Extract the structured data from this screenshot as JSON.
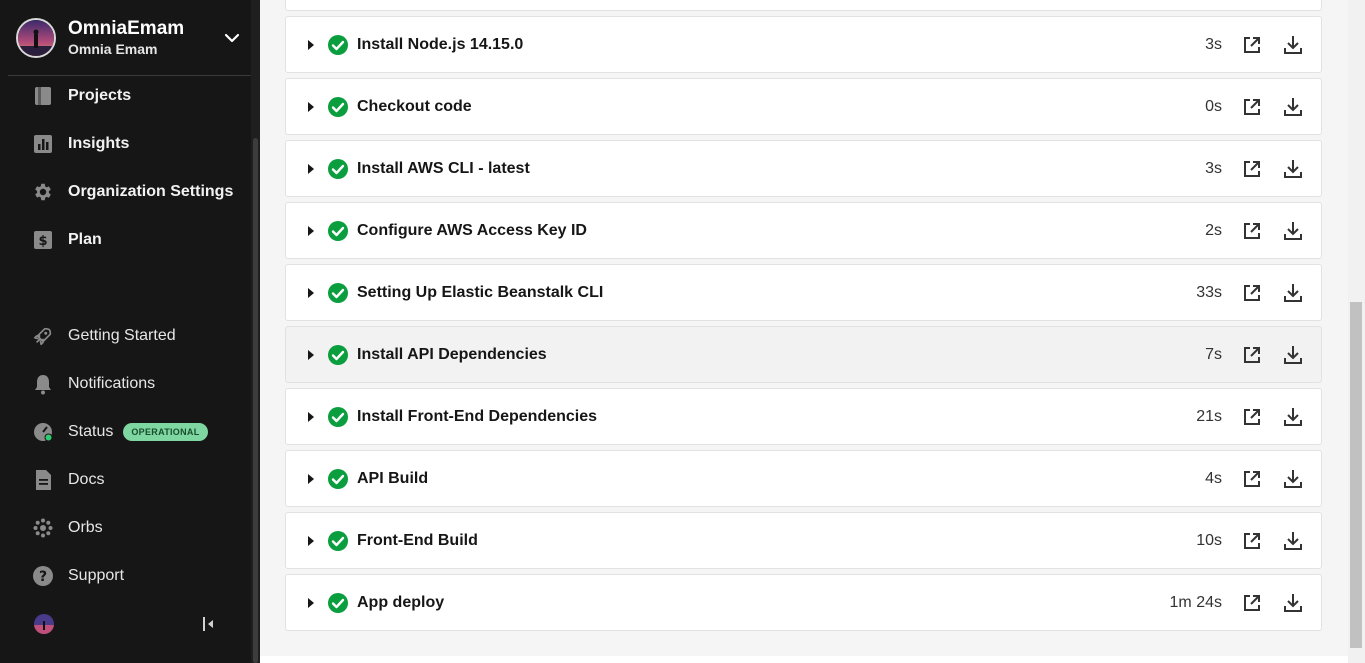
{
  "sidebar": {
    "org_name": "OmniaEmam",
    "user_name": "Omnia Emam",
    "primary_nav": [
      {
        "label": "Projects",
        "icon": "book-icon"
      },
      {
        "label": "Insights",
        "icon": "chart-icon"
      },
      {
        "label": "Organization Settings",
        "icon": "gear-icon"
      },
      {
        "label": "Plan",
        "icon": "dollar-icon"
      }
    ],
    "secondary_nav": [
      {
        "label": "Getting Started",
        "icon": "rocket-icon"
      },
      {
        "label": "Notifications",
        "icon": "bell-icon"
      },
      {
        "label": "Status",
        "icon": "status-icon",
        "badge": "OPERATIONAL"
      },
      {
        "label": "Docs",
        "icon": "doc-icon"
      },
      {
        "label": "Orbs",
        "icon": "orbs-icon"
      },
      {
        "label": "Support",
        "icon": "help-icon"
      }
    ]
  },
  "steps": [
    {
      "name": "Install Node.js 14.15.0",
      "duration": "3s"
    },
    {
      "name": "Checkout code",
      "duration": "0s"
    },
    {
      "name": "Install AWS CLI - latest",
      "duration": "3s"
    },
    {
      "name": "Configure AWS Access Key ID",
      "duration": "2s"
    },
    {
      "name": "Setting Up Elastic Beanstalk CLI",
      "duration": "33s"
    },
    {
      "name": "Install API Dependencies",
      "duration": "7s"
    },
    {
      "name": "Install Front-End Dependencies",
      "duration": "21s"
    },
    {
      "name": "API Build",
      "duration": "4s"
    },
    {
      "name": "Front-End Build",
      "duration": "10s"
    },
    {
      "name": "App deploy",
      "duration": "1m 24s"
    }
  ],
  "colors": {
    "sidebar_bg": "#161616",
    "success": "#0a9e3e",
    "badge_bg": "#7ed6a0"
  }
}
